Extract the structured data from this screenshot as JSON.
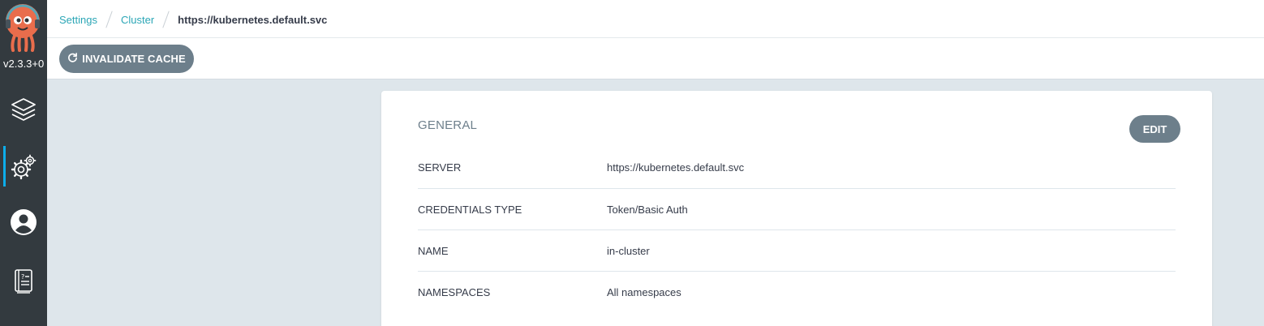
{
  "app": {
    "version": "v2.3.3+0"
  },
  "sidebar": {
    "items": [
      {
        "name": "applications",
        "icon": "layers-icon",
        "active": false
      },
      {
        "name": "settings",
        "icon": "gears-icon",
        "active": true
      },
      {
        "name": "user-info",
        "icon": "user-circle-icon",
        "active": false
      },
      {
        "name": "documentation",
        "icon": "help-book-icon",
        "active": false
      }
    ],
    "accent_color": "#0dadea"
  },
  "breadcrumb": {
    "items": [
      "Settings",
      "Cluster"
    ],
    "current": "https://kubernetes.default.svc"
  },
  "toolbar": {
    "invalidate_label": "INVALIDATE CACHE",
    "invalidate_icon": "refresh-icon"
  },
  "card": {
    "title": "GENERAL",
    "edit_label": "EDIT",
    "rows": [
      {
        "label": "SERVER",
        "value": "https://kubernetes.default.svc"
      },
      {
        "label": "CREDENTIALS TYPE",
        "value": "Token/Basic Auth"
      },
      {
        "label": "NAME",
        "value": "in-cluster"
      },
      {
        "label": "NAMESPACES",
        "value": "All namespaces"
      }
    ]
  },
  "colors": {
    "link": "#2ba6b6",
    "button": "#6d7f8b",
    "sidebar_bg": "#333a3f",
    "page_bg": "#dee6eb"
  }
}
